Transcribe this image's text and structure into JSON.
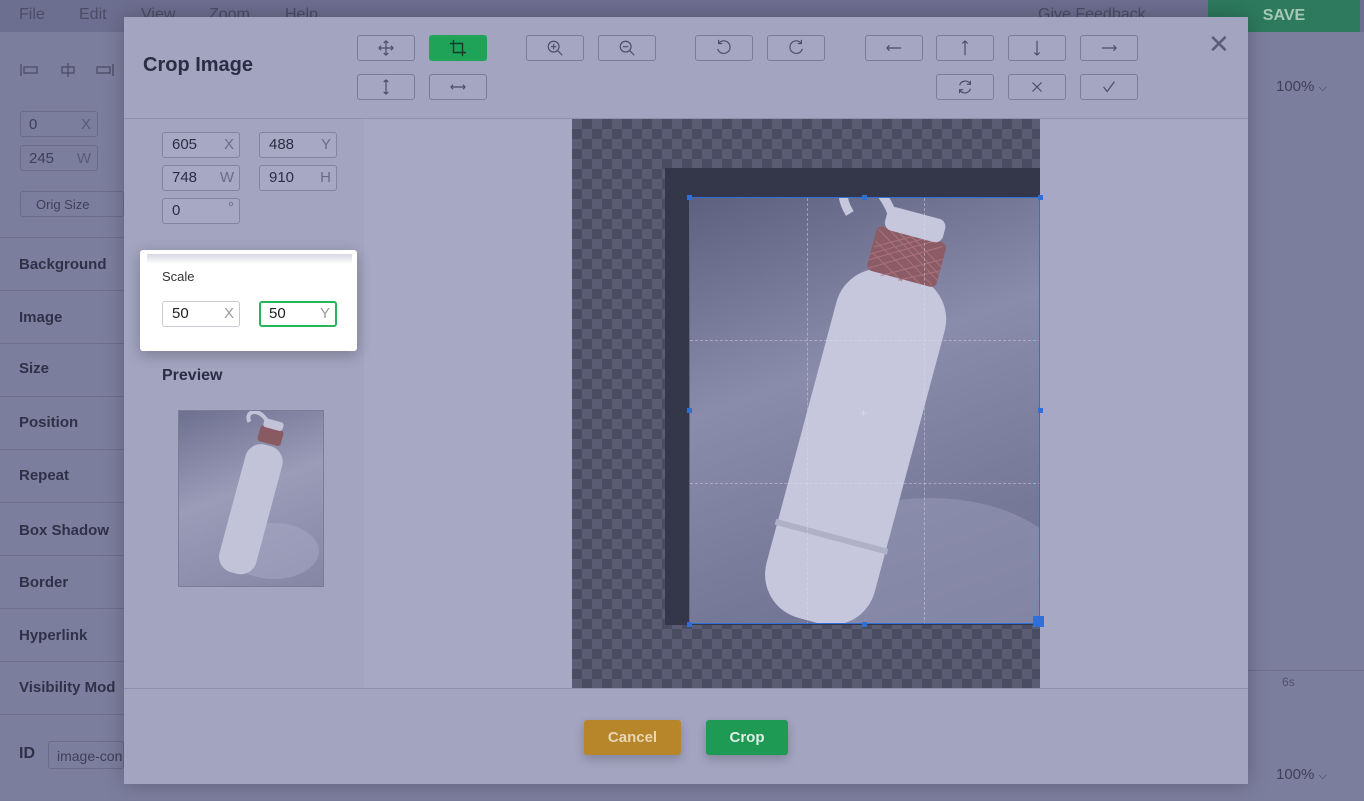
{
  "app": {
    "menu": [
      "File",
      "Edit",
      "View",
      "Zoom",
      "Help"
    ],
    "feedback_link": "Give Feedback",
    "save_label": "SAVE",
    "bg_fields": [
      {
        "value": "0",
        "suffix": "X"
      },
      {
        "value": "245",
        "suffix": "W"
      }
    ],
    "orig_size_label": "Orig Size",
    "sections": [
      "Background",
      "Image",
      "Size",
      "Position",
      "Repeat",
      "Box Shadow",
      "Border",
      "Hyperlink",
      "Visibility Mod"
    ],
    "id_label": "ID",
    "id_value": "image-con",
    "zoom_top": "100%",
    "zoom_bottom": "100%",
    "timeline_label": "6s"
  },
  "modal": {
    "title": "Crop Image",
    "toolbar": {
      "row1": [
        {
          "icon": "move-icon",
          "active": false
        },
        {
          "icon": "crop-icon",
          "active": true
        },
        {
          "icon": "zoom-in-icon",
          "active": false
        },
        {
          "icon": "zoom-out-icon",
          "active": false
        },
        {
          "icon": "rotate-left-icon",
          "active": false
        },
        {
          "icon": "rotate-right-icon",
          "active": false
        },
        {
          "icon": "arrow-left-icon",
          "active": false
        },
        {
          "icon": "arrow-up-icon",
          "active": false
        },
        {
          "icon": "arrow-down-icon",
          "active": false
        },
        {
          "icon": "arrow-right-icon",
          "active": false
        }
      ],
      "row2": [
        {
          "icon": "flip-vertical-icon"
        },
        {
          "icon": "flip-horizontal-icon"
        },
        {
          "icon": "reset-icon"
        },
        {
          "icon": "clear-icon"
        },
        {
          "icon": "check-icon"
        }
      ]
    },
    "fields": {
      "x": {
        "value": "605",
        "suffix": "X"
      },
      "y": {
        "value": "488",
        "suffix": "Y"
      },
      "w": {
        "value": "748",
        "suffix": "W"
      },
      "h": {
        "value": "910",
        "suffix": "H"
      },
      "rotate": {
        "value": "0",
        "suffix": "°"
      }
    },
    "scale": {
      "title": "Scale",
      "x": {
        "value": "50",
        "suffix": "X"
      },
      "y": {
        "value": "50",
        "suffix": "Y"
      }
    },
    "preview_label": "Preview",
    "cancel_label": "Cancel",
    "crop_label": "Crop",
    "colors": {
      "accent": "#1fa358",
      "crop_box": "#2f6fd8",
      "cancel": "#b8862a"
    }
  }
}
